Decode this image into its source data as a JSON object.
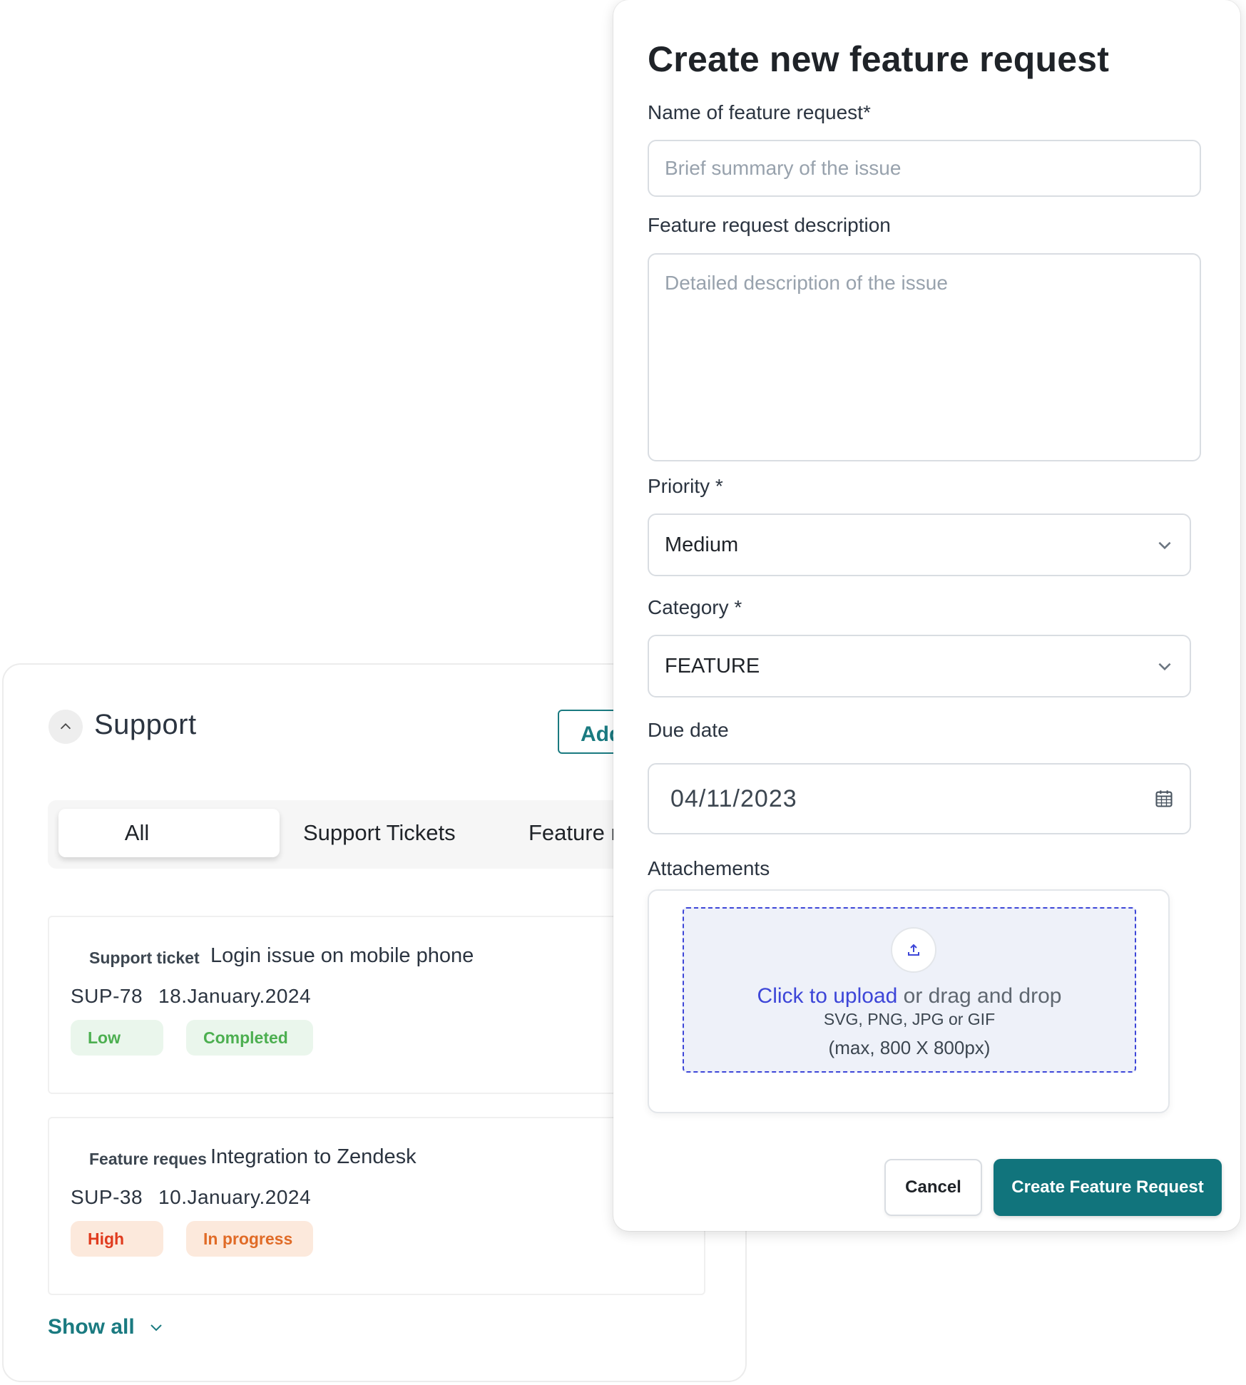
{
  "colors": {
    "accent": "#11747c",
    "link": "#3d46d8",
    "low_badge_text": "#4caf50",
    "high_badge_text": "#e03b1e",
    "in_progress_text": "#e06b27"
  },
  "support": {
    "title": "Support",
    "add_button_label": "Add",
    "tabs": [
      {
        "label": "All",
        "active": true
      },
      {
        "label": "Support Tickets",
        "active": false
      },
      {
        "label": "Feature r",
        "active": false
      }
    ],
    "tickets": [
      {
        "type": "Support ticket",
        "title": "Login issue on mobile phone",
        "id": "SUP-78",
        "date": "18.January.2024",
        "priority": "Low",
        "status": "Completed"
      },
      {
        "type": "Feature reques",
        "title": "Integration to Zendesk",
        "id": "SUP-38",
        "date": "10.January.2024",
        "priority": "High",
        "status": "In progress"
      }
    ],
    "show_all_label": "Show all"
  },
  "modal": {
    "title": "Create new feature request",
    "name_label": "Name of feature request*",
    "name_placeholder": "Brief summary of the issue",
    "description_label": "Feature request description",
    "description_placeholder": "Detailed description of the issue",
    "priority_label": "Priority *",
    "priority_value": "Medium",
    "category_label": "Category *",
    "category_value": "FEATURE",
    "due_date_label": "Due date",
    "due_date_value": "04/11/2023",
    "attachments_label": "Attachements",
    "upload_link": "Click to upload",
    "upload_rest": " or drag and drop",
    "upload_formats": "SVG, PNG, JPG or GIF",
    "upload_limit": "(max, 800 X 800px)",
    "cancel_label": "Cancel",
    "create_label": "Create Feature Request"
  },
  "icons": {
    "collapse": "chevron-up-icon",
    "show_all": "chevron-down-icon",
    "select": "chevron-down-icon",
    "date": "calendar-icon",
    "upload": "upload-icon"
  }
}
